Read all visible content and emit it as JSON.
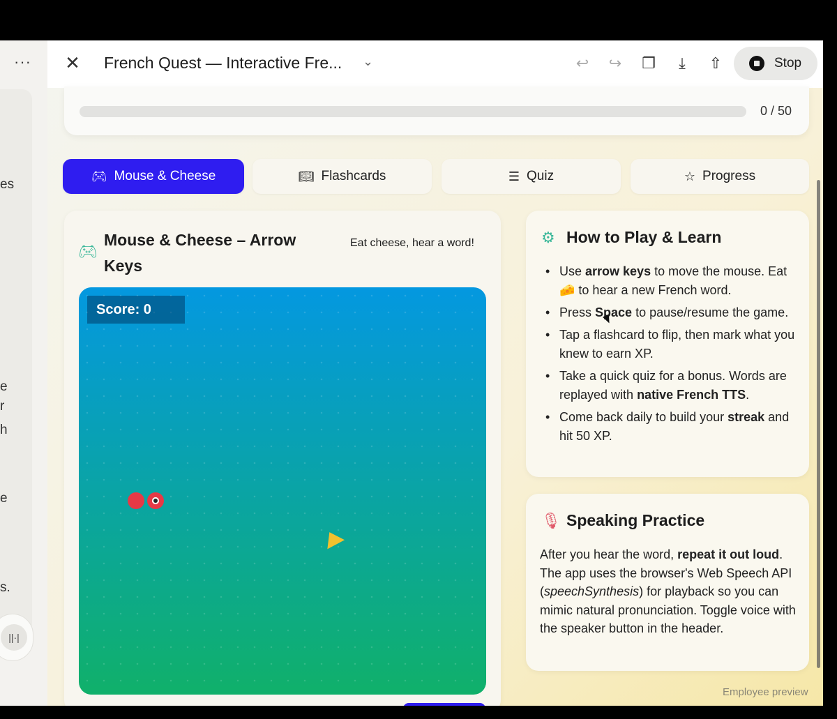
{
  "left_panel": {
    "menu_label": "···",
    "fragments": [
      "es",
      "e",
      "r",
      "h",
      "e",
      "s."
    ],
    "voice_icon": "waveform-icon"
  },
  "header": {
    "close_icon": "close-icon",
    "title": "French Quest — Interactive Fre...",
    "title_chevron": "chevron-down-icon",
    "undo_icon": "undo-icon",
    "redo_icon": "redo-icon",
    "copy_icon": "copy-icon",
    "download_icon": "download-icon",
    "share_icon": "share-icon",
    "stop_label": "Stop"
  },
  "progress": {
    "current": 0,
    "max": 50,
    "text": "0 / 50"
  },
  "tabs": [
    {
      "label": "Mouse & Cheese",
      "icon": "gamepad-icon",
      "active": true
    },
    {
      "label": "Flashcards",
      "icon": "book-open-icon",
      "active": false
    },
    {
      "label": "Quiz",
      "icon": "list-checks-icon",
      "active": false
    },
    {
      "label": "Progress",
      "icon": "star-icon",
      "active": false
    }
  ],
  "game": {
    "title": "Mouse & Cheese – Arrow Keys",
    "subtitle": "Eat cheese, hear a word!",
    "score_label": "Score: 0"
  },
  "how_to": {
    "title": "How to Play & Learn",
    "items": [
      [
        "Use ",
        {
          "b": "arrow keys"
        },
        " to move the mouse. Eat ",
        {
          "emoji": "🧀"
        },
        " to hear a new French word."
      ],
      [
        "Press ",
        {
          "b": "Space"
        },
        " to pause/resume the game."
      ],
      [
        "Tap a flashcard to flip, then mark what you knew to earn XP."
      ],
      [
        "Take a quick quiz for a bonus. Words are replayed with ",
        {
          "b": "native French TTS"
        },
        "."
      ],
      [
        "Come back daily to build your ",
        {
          "b": "streak"
        },
        " and hit 50 XP."
      ]
    ]
  },
  "speaking": {
    "title": "Speaking Practice",
    "text_parts": [
      "After you hear the word, ",
      {
        "b": "repeat it out loud"
      },
      ". The app uses the browser's Web Speech API (",
      {
        "i": "speechSynthesis"
      },
      ") for playback so you can mimic natural pronunciation. Toggle voice with the speaker button in the header."
    ]
  },
  "footer": {
    "preview_label": "Employee preview"
  },
  "colors": {
    "accent": "#2f1df0",
    "board_top": "#0498e0",
    "board_bottom": "#10b06a",
    "mouse": "#e63946",
    "cheese": "#f2c12e",
    "game_icon": "#3cb89a",
    "mic_icon": "#e05a6a"
  }
}
